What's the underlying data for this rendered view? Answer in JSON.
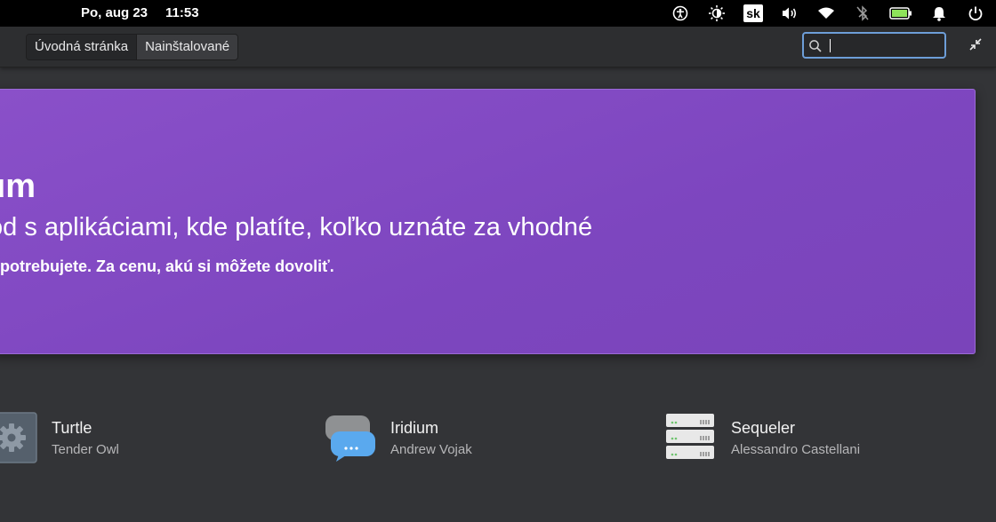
{
  "topbar": {
    "date": "Po, aug 23",
    "time": "11:53",
    "keyboard_layout": "sk",
    "icons": [
      "accessibility-icon",
      "night-light-icon",
      "keyboard-layout-indicator",
      "volume-icon",
      "wifi-icon",
      "bluetooth-disabled-icon",
      "battery-icon",
      "notifications-icon",
      "power-icon"
    ]
  },
  "header": {
    "tabs": [
      "Úvodná stránka",
      "Nainštalované"
    ],
    "active_tab": "Nainštalované",
    "search": {
      "value": "",
      "placeholder": ""
    }
  },
  "banner": {
    "title": "um",
    "subtitle": "od s aplikáciami, kde platíte, koľko uznáte za vhodné",
    "description": "é potrebujete. Za cenu, akú si môžete dovoliť.",
    "color": "#8049c2"
  },
  "apps": [
    {
      "name": "Turtle",
      "author": "Tender Owl",
      "icon": "gear-icon"
    },
    {
      "name": "Iridium",
      "author": "Andrew Vojak",
      "icon": "chat-bubbles-icon"
    },
    {
      "name": "Sequeler",
      "author": "Alessandro Castellani",
      "icon": "server-stack-icon"
    }
  ]
}
